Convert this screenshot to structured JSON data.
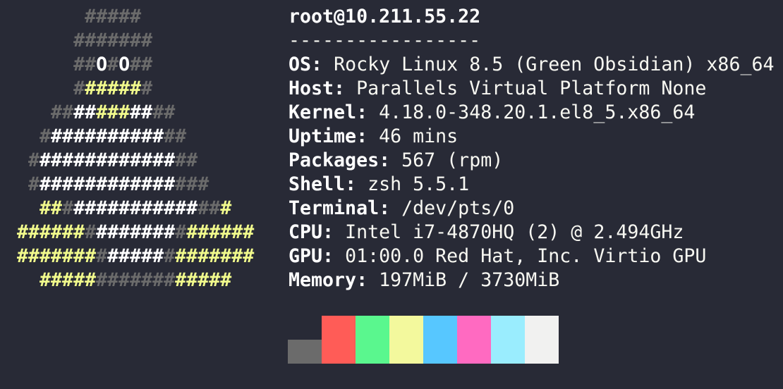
{
  "logo": {
    "lines": [
      [
        {
          "t": "      ",
          "c": "space"
        },
        {
          "t": "#####",
          "c": "gray"
        }
      ],
      [
        {
          "t": "     ",
          "c": "space"
        },
        {
          "t": "#######",
          "c": "gray"
        }
      ],
      [
        {
          "t": "     ",
          "c": "space"
        },
        {
          "t": "##",
          "c": "gray"
        },
        {
          "t": "O",
          "c": "white"
        },
        {
          "t": "#",
          "c": "gray"
        },
        {
          "t": "O",
          "c": "white"
        },
        {
          "t": "##",
          "c": "gray"
        }
      ],
      [
        {
          "t": "     ",
          "c": "space"
        },
        {
          "t": "#",
          "c": "gray"
        },
        {
          "t": "#####",
          "c": "yellow"
        },
        {
          "t": "#",
          "c": "gray"
        }
      ],
      [
        {
          "t": "   ",
          "c": "space"
        },
        {
          "t": "##",
          "c": "gray"
        },
        {
          "t": "##",
          "c": "white"
        },
        {
          "t": "###",
          "c": "yellow"
        },
        {
          "t": "##",
          "c": "white"
        },
        {
          "t": "##",
          "c": "gray"
        }
      ],
      [
        {
          "t": "  ",
          "c": "space"
        },
        {
          "t": "#",
          "c": "gray"
        },
        {
          "t": "##########",
          "c": "white"
        },
        {
          "t": "##",
          "c": "gray"
        }
      ],
      [
        {
          "t": " ",
          "c": "space"
        },
        {
          "t": "#",
          "c": "gray"
        },
        {
          "t": "############",
          "c": "white"
        },
        {
          "t": "##",
          "c": "gray"
        }
      ],
      [
        {
          "t": " ",
          "c": "space"
        },
        {
          "t": "#",
          "c": "gray"
        },
        {
          "t": "############",
          "c": "white"
        },
        {
          "t": "###",
          "c": "gray"
        }
      ],
      [
        {
          "t": "  ",
          "c": "space"
        },
        {
          "t": "##",
          "c": "yellow"
        },
        {
          "t": "#",
          "c": "gray"
        },
        {
          "t": "###########",
          "c": "white"
        },
        {
          "t": "##",
          "c": "gray"
        },
        {
          "t": "#",
          "c": "yellow"
        }
      ],
      [
        {
          "t": "######",
          "c": "yellow"
        },
        {
          "t": "#",
          "c": "gray"
        },
        {
          "t": "#######",
          "c": "white"
        },
        {
          "t": "#",
          "c": "gray"
        },
        {
          "t": "######",
          "c": "yellow"
        }
      ],
      [
        {
          "t": "#######",
          "c": "yellow"
        },
        {
          "t": "#",
          "c": "gray"
        },
        {
          "t": "#####",
          "c": "white"
        },
        {
          "t": "#",
          "c": "gray"
        },
        {
          "t": "#######",
          "c": "yellow"
        }
      ],
      [
        {
          "t": "  ",
          "c": "space"
        },
        {
          "t": "#####",
          "c": "yellow"
        },
        {
          "t": "#######",
          "c": "gray"
        },
        {
          "t": "#####",
          "c": "yellow"
        }
      ]
    ]
  },
  "info": {
    "title": "root@10.211.55.22",
    "underline": "-----------------",
    "rows": [
      {
        "key": "OS",
        "value": "Rocky Linux 8.5 (Green Obsidian) x86_64"
      },
      {
        "key": "Host",
        "value": "Parallels Virtual Platform None"
      },
      {
        "key": "Kernel",
        "value": "4.18.0-348.20.1.el8_5.x86_64"
      },
      {
        "key": "Uptime",
        "value": "46 mins"
      },
      {
        "key": "Packages",
        "value": "567 (rpm)"
      },
      {
        "key": "Shell",
        "value": "zsh 5.5.1"
      },
      {
        "key": "Terminal",
        "value": "/dev/pts/0"
      },
      {
        "key": "CPU",
        "value": "Intel i7-4870HQ (2) @ 2.494GHz"
      },
      {
        "key": "GPU",
        "value": "01:00.0 Red Hat, Inc. Virtio GPU"
      },
      {
        "key": "Memory",
        "value": "197MiB / 3730MiB"
      }
    ],
    "separator": ": "
  },
  "palette": {
    "colors": [
      "#6b6b6b",
      "#ff5c57",
      "#5af78e",
      "#f3f99d",
      "#57c7ff",
      "#ff6ac1",
      "#9aedfe",
      "#f1f1f0"
    ]
  }
}
